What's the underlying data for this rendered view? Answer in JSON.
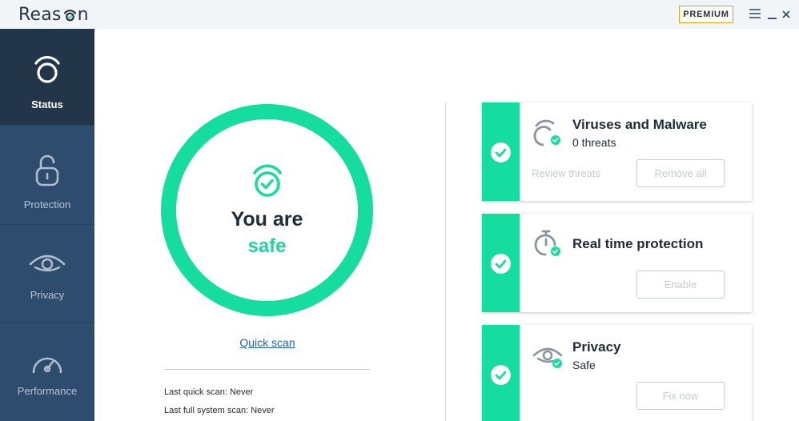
{
  "app": {
    "name_prefix": "Reas",
    "name_suffix": "n",
    "premium_label": "PREMIUM"
  },
  "sidebar": {
    "items": [
      {
        "label": "Status",
        "icon": "shield-status-icon",
        "active": true
      },
      {
        "label": "Protection",
        "icon": "lock-icon",
        "active": false
      },
      {
        "label": "Privacy",
        "icon": "eye-icon",
        "active": false
      },
      {
        "label": "Performance",
        "icon": "speedometer-icon",
        "active": false
      }
    ]
  },
  "status": {
    "line1": "You are",
    "line2": "safe",
    "quick_scan_label": "Quick scan",
    "last_quick_scan_label": "Last quick scan:",
    "last_quick_scan_value": "Never",
    "last_full_scan_label": "Last full system scan:",
    "last_full_scan_value": "Never"
  },
  "cards": [
    {
      "title": "Viruses and Malware",
      "subtitle": "0 threats",
      "link": "Review threats",
      "button": "Remove all"
    },
    {
      "title": "Real time protection",
      "subtitle": "",
      "button": "Enable"
    },
    {
      "title": "Privacy",
      "subtitle": "Safe",
      "button": "Fix now"
    }
  ],
  "colors": {
    "accent": "#15dc9f",
    "sidebar": "#2e4d6e",
    "sidebar_active": "#233649",
    "premium_border": "#d9a21e"
  }
}
